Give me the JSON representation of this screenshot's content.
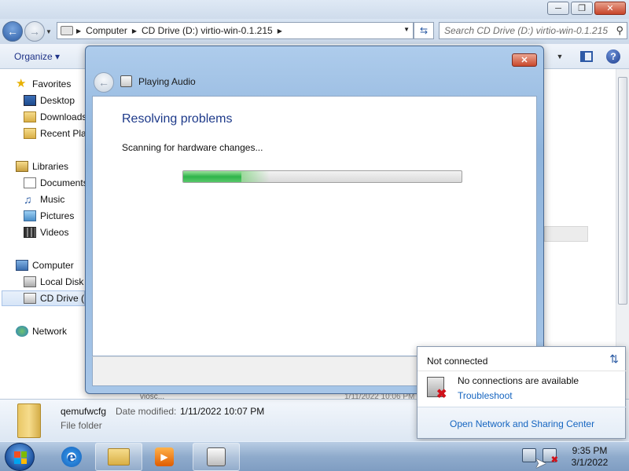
{
  "explorer": {
    "breadcrumbs": [
      "Computer",
      "CD Drive (D:) virtio-win-0.1.215"
    ],
    "search_placeholder": "Search CD Drive (D:) virtio-win-0.1.215",
    "toolbar": {
      "organize_label": "Organize ▾"
    },
    "nav": {
      "favorites": "Favorites",
      "desktop": "Desktop",
      "downloads": "Downloads",
      "recent": "Recent Places",
      "libraries": "Libraries",
      "documents": "Documents",
      "music": "Music",
      "pictures": "Pictures",
      "videos": "Videos",
      "computer": "Computer",
      "localdisk": "Local Disk",
      "cddrive": "CD Drive (D:)",
      "network": "Network"
    },
    "details": {
      "name": "qemufwcfg",
      "date_label": "Date modified:",
      "date_value": "1/11/2022 10:07 PM",
      "type": "File folder"
    },
    "peek_row": {
      "name": "viosc...",
      "date": "1/11/2022 10:06 PM"
    }
  },
  "dialog": {
    "title": "Playing Audio",
    "heading": "Resolving problems",
    "status": "Scanning for hardware changes...",
    "progress_fraction": 0.21,
    "close_label": "✕"
  },
  "flyout": {
    "title": "Not connected",
    "message": "No connections are available",
    "troubleshoot": "Troubleshoot",
    "footer_link": "Open Network and Sharing Center"
  },
  "taskbar": {
    "time": "9:35 PM",
    "date": "3/1/2022"
  },
  "colors": {
    "link": "#1565c0",
    "heading": "#1e3a8a",
    "progress_green": "#2fb44a",
    "taskbar": "#8fabcc"
  }
}
